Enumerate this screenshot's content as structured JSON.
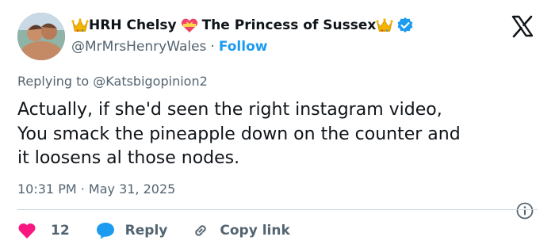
{
  "author": {
    "display_name_part1": "HRH Chelsy",
    "display_name_part2": "The Princess of Sussex",
    "handle": "@MrMrsHenryWales",
    "separator": "·",
    "follow_label": "Follow",
    "verified": true
  },
  "reply_context": {
    "prefix": "Replying to",
    "mention": "@Katsbigopinion2"
  },
  "tweet": {
    "lines": [
      "Actually, if she'd seen the right instagram video,",
      "You smack the pineapple down on the counter and",
      "it loosens al those nodes."
    ],
    "timestamp": "10:31 PM · May 31, 2025"
  },
  "actions": {
    "like_count": "12",
    "reply_label": "Reply",
    "copy_label": "Copy link"
  },
  "colors": {
    "accent": "#1d9bf0",
    "like": "#f91880",
    "secondary_text": "#536471",
    "primary_text": "#0f1419",
    "crown": "#f4b400"
  },
  "icons": [
    "crown-icon",
    "heart-ribbon-icon",
    "verified-badge-icon",
    "x-logo-icon",
    "info-icon",
    "heart-icon",
    "reply-bubble-icon",
    "link-icon"
  ]
}
